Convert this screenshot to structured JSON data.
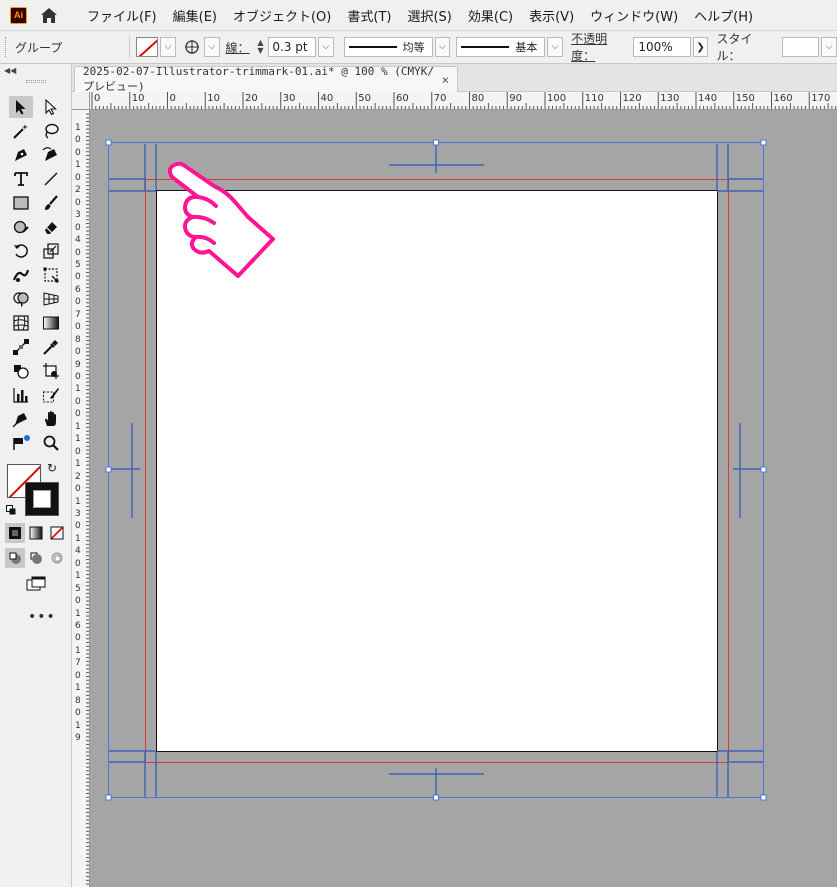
{
  "app": {
    "logo": "Ai",
    "home_icon": "home-icon"
  },
  "menu": [
    {
      "label": "ファイル(F)"
    },
    {
      "label": "編集(E)"
    },
    {
      "label": "オブジェクト(O)"
    },
    {
      "label": "書式(T)"
    },
    {
      "label": "選択(S)"
    },
    {
      "label": "効果(C)"
    },
    {
      "label": "表示(V)"
    },
    {
      "label": "ウィンドウ(W)"
    },
    {
      "label": "ヘルプ(H)"
    }
  ],
  "control": {
    "selection_label": "グループ",
    "fill_swatch": "none",
    "stroke_label": "線：",
    "stroke_weight": "0.3 pt",
    "profile_label": "均等",
    "brush_label": "基本",
    "opacity_label": "不透明度：",
    "opacity_value": "100%",
    "style_label": "スタイル："
  },
  "document": {
    "tab_title": "2025-02-07-Illustrator-trimmark-01.ai* @ 100 % (CMYK/プレビュー)",
    "close_glyph": "×"
  },
  "rulers": {
    "horizontal": [
      "0",
      "10",
      "0",
      "10",
      "20",
      "30",
      "40",
      "50",
      "60",
      "70",
      "80",
      "90",
      "100",
      "110",
      "120",
      "130",
      "140",
      "150",
      "160",
      "170"
    ],
    "vertical": [
      "1",
      "0",
      "0",
      "1",
      "0",
      "2",
      "0",
      "3",
      "0",
      "4",
      "0",
      "5",
      "0",
      "6",
      "0",
      "7",
      "0",
      "8",
      "0",
      "9",
      "0",
      "1",
      "0",
      "0",
      "1",
      "1",
      "0",
      "1",
      "2",
      "0",
      "1",
      "3",
      "0",
      "1",
      "4",
      "0",
      "1",
      "5",
      "0",
      "1",
      "6",
      "0",
      "1",
      "7",
      "0",
      "1",
      "8",
      "0",
      "1",
      "9"
    ]
  },
  "colors": {
    "canvas_bg": "#a5a5a5",
    "artboard": "#ffffff",
    "bleed": "#d83a3a",
    "selection": "#4a78d8",
    "trim_marks": "#3f63b5",
    "pointer_hand": "#ff1493"
  },
  "annotation": {
    "icon": "pointing-hand-icon"
  }
}
